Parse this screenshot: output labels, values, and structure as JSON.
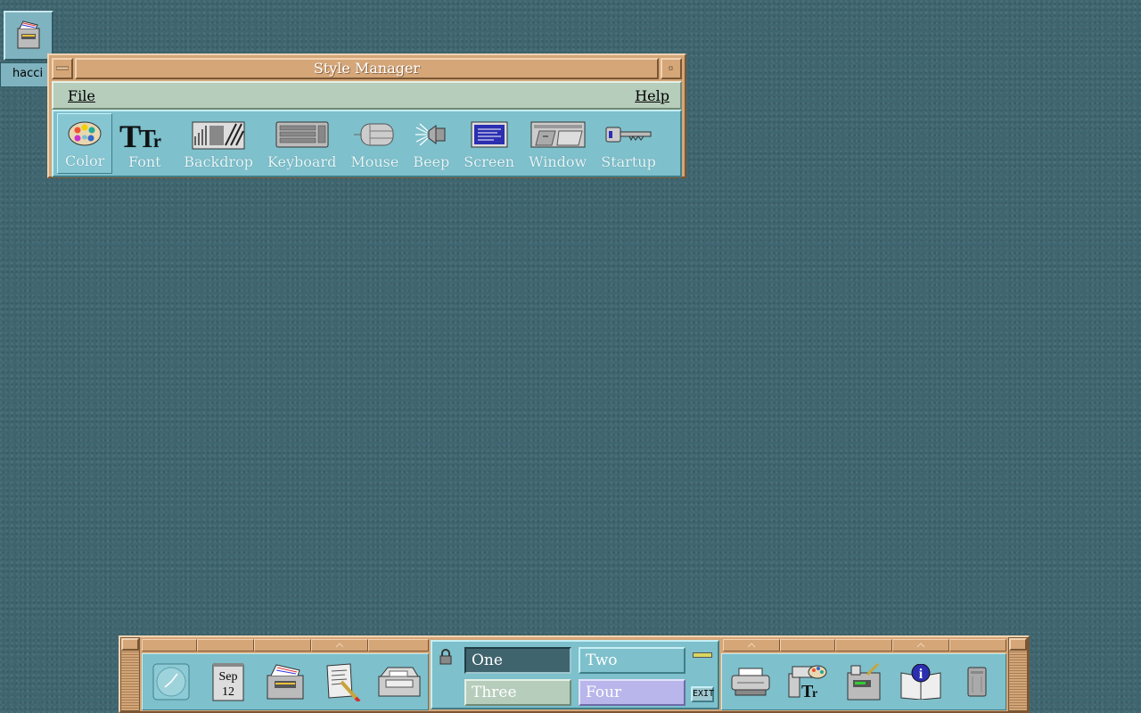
{
  "desktop": {
    "icon_label": "hacci"
  },
  "style_manager": {
    "title": "Style Manager",
    "menu": {
      "file": "File",
      "help": "Help"
    },
    "tools": [
      {
        "label": "Color",
        "icon": "palette-icon"
      },
      {
        "label": "Font",
        "icon": "font-icon"
      },
      {
        "label": "Backdrop",
        "icon": "backdrop-icon"
      },
      {
        "label": "Keyboard",
        "icon": "keyboard-icon"
      },
      {
        "label": "Mouse",
        "icon": "mouse-icon"
      },
      {
        "label": "Beep",
        "icon": "speaker-icon"
      },
      {
        "label": "Screen",
        "icon": "screen-icon"
      },
      {
        "label": "Window",
        "icon": "window-icon"
      },
      {
        "label": "Startup",
        "icon": "key-icon"
      }
    ]
  },
  "front_panel": {
    "calendar": {
      "month": "Sep",
      "day": "12"
    },
    "workspaces": [
      "One",
      "Two",
      "Three",
      "Four"
    ],
    "exit_label": "EXIT"
  },
  "colors": {
    "desktop_bg": "#3f6670",
    "window_frame": "#d4a678",
    "menubar": "#b6cdbb",
    "toolbar": "#7ec0cc",
    "workspace_four": "#b8b6ea"
  }
}
